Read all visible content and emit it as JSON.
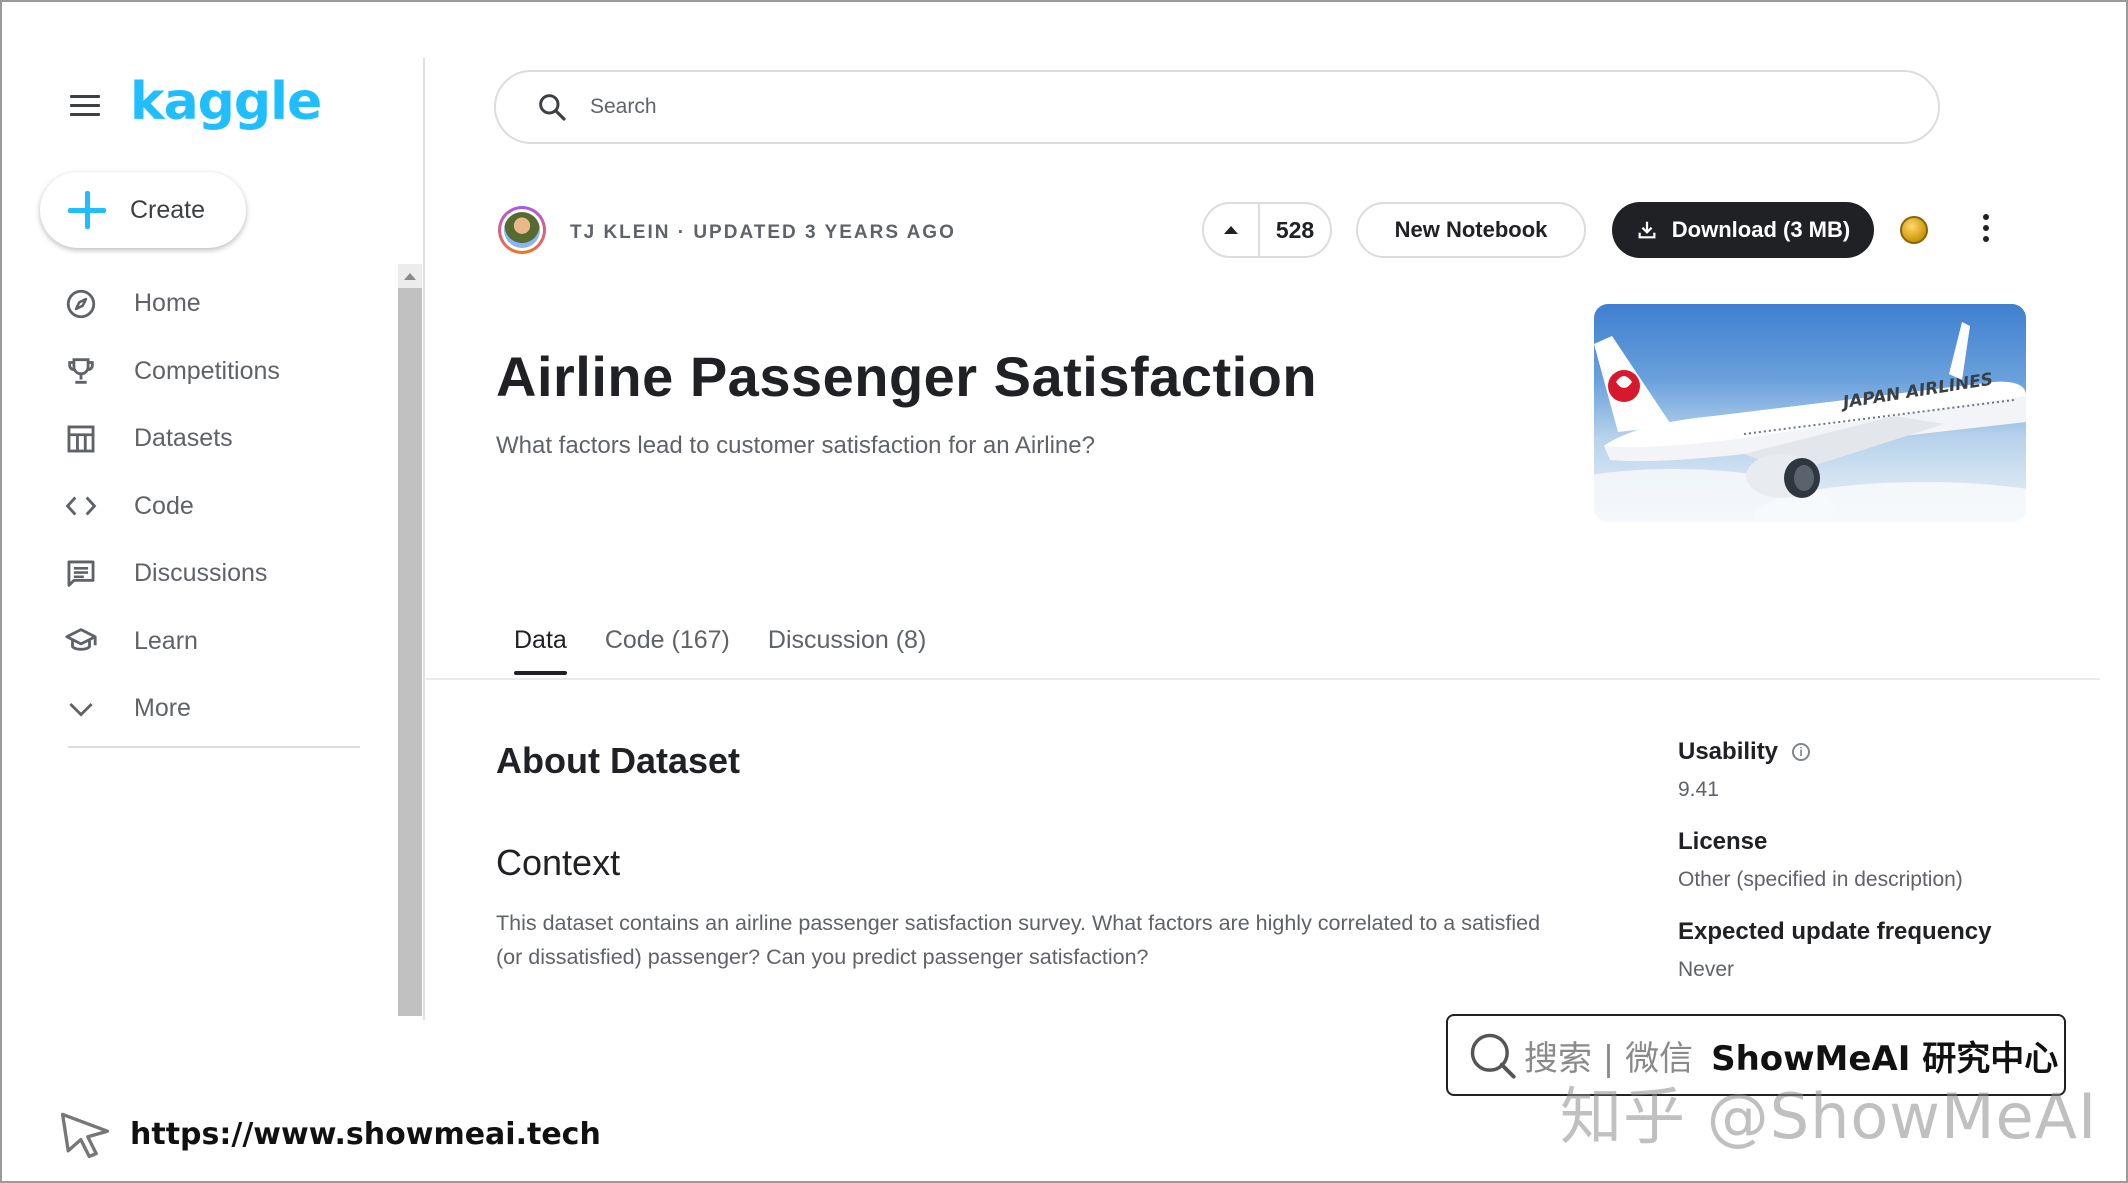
{
  "sidebar": {
    "logo": "kaggle",
    "create_label": "Create",
    "items": [
      {
        "label": "Home",
        "icon": "compass-icon"
      },
      {
        "label": "Competitions",
        "icon": "trophy-icon"
      },
      {
        "label": "Datasets",
        "icon": "table-icon"
      },
      {
        "label": "Code",
        "icon": "code-icon"
      },
      {
        "label": "Discussions",
        "icon": "comment-icon"
      },
      {
        "label": "Learn",
        "icon": "school-icon"
      },
      {
        "label": "More",
        "icon": "chevron-down-icon"
      }
    ]
  },
  "search": {
    "placeholder": "Search"
  },
  "header": {
    "byline": "TJ KLEIN · UPDATED 3 YEARS AGO",
    "votes": "528",
    "new_notebook_label": "New Notebook",
    "download_label": "Download (3 MB)"
  },
  "dataset": {
    "title": "Airline Passenger Satisfaction",
    "subtitle": "What factors lead to customer satisfaction for an Airline?",
    "cover_text": "JAPAN AIRLINES"
  },
  "tabs": [
    {
      "label": "Data",
      "active": true
    },
    {
      "label": "Code (167)",
      "active": false
    },
    {
      "label": "Discussion (8)",
      "active": false
    }
  ],
  "body": {
    "about_heading": "About Dataset",
    "context_heading": "Context",
    "context_line1": "This dataset contains an airline passenger satisfaction survey. What factors are highly correlated to a satisfied",
    "context_line2": "(or dissatisfied) passenger? Can you predict passenger satisfaction?"
  },
  "meta": {
    "usability_label": "Usability",
    "usability_value": "9.41",
    "license_label": "License",
    "license_value": "Other (specified in description)",
    "frequency_label": "Expected update frequency",
    "frequency_value": "Never"
  },
  "watermark": {
    "search_text": "搜索 | 微信",
    "brand_text": "ShowMeAI 研究中心",
    "zhihu_text": "知乎 @ShowMeAI",
    "url": "https://www.showmeai.tech"
  },
  "colors": {
    "brand": "#20beff",
    "dark_button": "#202124",
    "text_secondary": "#5f6368"
  }
}
